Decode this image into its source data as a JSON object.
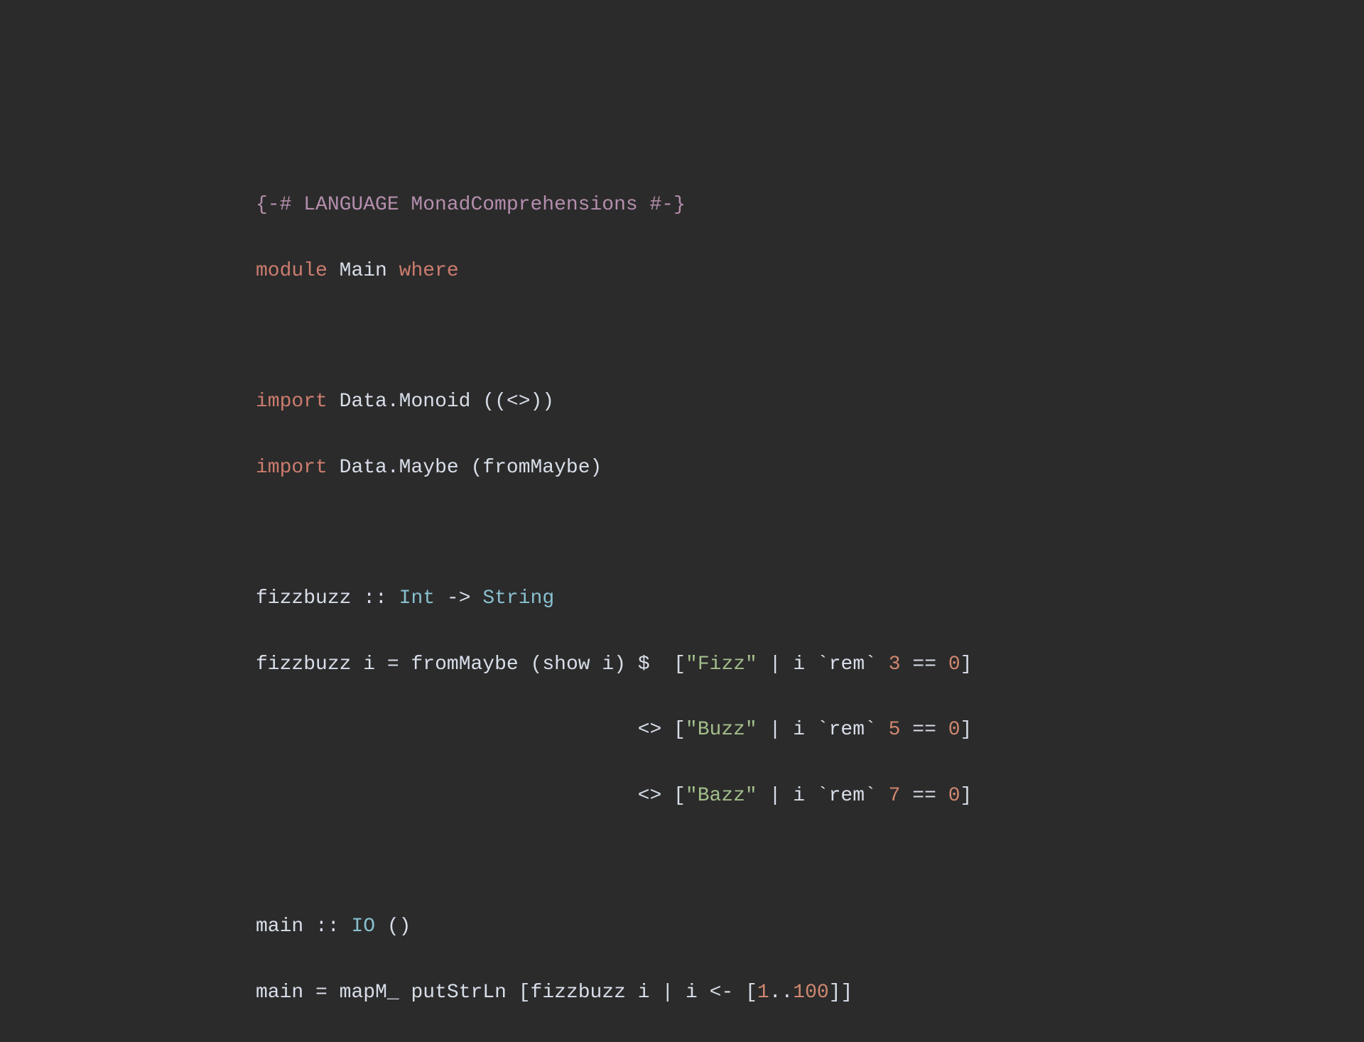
{
  "code": {
    "line1": {
      "pragma": "{-# LANGUAGE MonadComprehensions #-}"
    },
    "line2": {
      "kw_module": "module",
      "name": "Main",
      "kw_where": "where"
    },
    "line4": {
      "kw_import": "import",
      "module": "Data.Monoid",
      "parens": "((<>))"
    },
    "line5": {
      "kw_import": "import",
      "module": "Data.Maybe",
      "parens": "(fromMaybe)"
    },
    "line7": {
      "name": "fizzbuzz",
      "colons": "::",
      "type1": "Int",
      "arrow": "->",
      "type2": "String"
    },
    "line8": {
      "name": "fizzbuzz",
      "param": "i",
      "eq": "=",
      "func": "fromMaybe",
      "paren_open": "(",
      "show": "show",
      "show_arg": "i",
      "paren_close": ")",
      "dollar": "$",
      "bracket_open": "[",
      "str": "\"Fizz\"",
      "pipe": "|",
      "cond_i": "i",
      "backtick_open": "`",
      "rem": "rem",
      "backtick_close": "`",
      "num": "3",
      "eqeq": "==",
      "zero": "0",
      "bracket_close": "]"
    },
    "line9": {
      "indent": "                                ",
      "op": "<>",
      "bracket_open": "[",
      "str": "\"Buzz\"",
      "pipe": "|",
      "cond_i": "i",
      "backtick_open": "`",
      "rem": "rem",
      "backtick_close": "`",
      "num": "5",
      "eqeq": "==",
      "zero": "0",
      "bracket_close": "]"
    },
    "line10": {
      "indent": "                                ",
      "op": "<>",
      "bracket_open": "[",
      "str": "\"Bazz\"",
      "pipe": "|",
      "cond_i": "i",
      "backtick_open": "`",
      "rem": "rem",
      "backtick_close": "`",
      "num": "7",
      "eqeq": "==",
      "zero": "0",
      "bracket_close": "]"
    },
    "line12": {
      "name": "main",
      "colons": "::",
      "type1": "IO",
      "unit": "()"
    },
    "line13": {
      "name": "main",
      "eq": "=",
      "mapm": "mapM_",
      "putstrln": "putStrLn",
      "bracket_open": "[",
      "fizzbuzz": "fizzbuzz",
      "i1": "i",
      "pipe": "|",
      "i2": "i",
      "arrow": "<-",
      "range_open": "[",
      "one": "1",
      "dots": "..",
      "hundred": "100",
      "range_close": "]",
      "bracket_close": "]"
    }
  }
}
